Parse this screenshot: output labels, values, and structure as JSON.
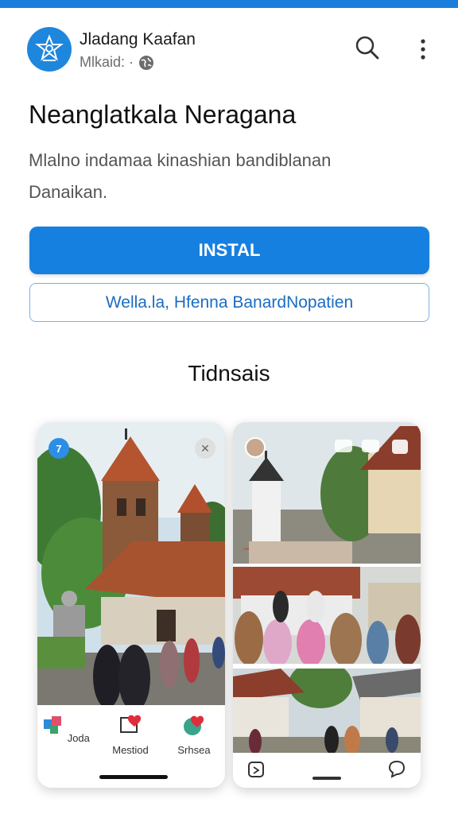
{
  "app": {
    "name": "Jladang Kaafan",
    "subtitle": "Mlkaid: ·"
  },
  "icons": {
    "logo": "emblem-icon",
    "search": "search-icon",
    "more": "more-vert-icon",
    "globe": "globe-icon"
  },
  "page": {
    "title": "Neanglatkala Neragana",
    "description": "Mlalno indamaa kinashian bandiblanan Danaikan."
  },
  "buttons": {
    "install": "INSTAL",
    "secondary": "Wella.la, Hfenna BanardNopatien"
  },
  "screenshots": {
    "section_title": "Tidnsais",
    "left_card": {
      "badge": "7",
      "tabs": [
        {
          "label": "Joda",
          "icon": "puzzle-icon"
        },
        {
          "label": "Mestiod",
          "icon": "heart-message-icon"
        },
        {
          "label": "Srhsea",
          "icon": "heart-bubble-icon"
        }
      ]
    }
  },
  "colors": {
    "accent": "#1680e0",
    "topbar": "#1a7fdc"
  }
}
